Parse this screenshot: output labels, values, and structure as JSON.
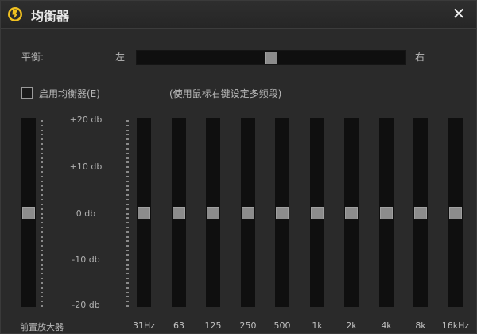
{
  "window": {
    "title": "均衡器",
    "close_label": "✕"
  },
  "balance": {
    "label": "平衡:",
    "left": "左",
    "right": "右",
    "value": 0.5
  },
  "enable": {
    "label": "启用均衡器(E)",
    "checked": false
  },
  "hint": "(使用鼠标右键设定多频段)",
  "scale": [
    "+20 db",
    "+10 db",
    "0 db",
    "-10 db",
    "-20 db"
  ],
  "preamp": {
    "label": "前置放大器",
    "value_db": 0
  },
  "bands": [
    {
      "label": "31Hz",
      "value_db": 0
    },
    {
      "label": "63",
      "value_db": 0
    },
    {
      "label": "125",
      "value_db": 0
    },
    {
      "label": "250",
      "value_db": 0
    },
    {
      "label": "500",
      "value_db": 0
    },
    {
      "label": "1k",
      "value_db": 0
    },
    {
      "label": "2k",
      "value_db": 0
    },
    {
      "label": "4k",
      "value_db": 0
    },
    {
      "label": "8k",
      "value_db": 0
    },
    {
      "label": "16kHz",
      "value_db": 0
    }
  ],
  "colors": {
    "accent": "#f0c020",
    "track": "#0f0f0f",
    "thumb": "#8c8c8c"
  }
}
